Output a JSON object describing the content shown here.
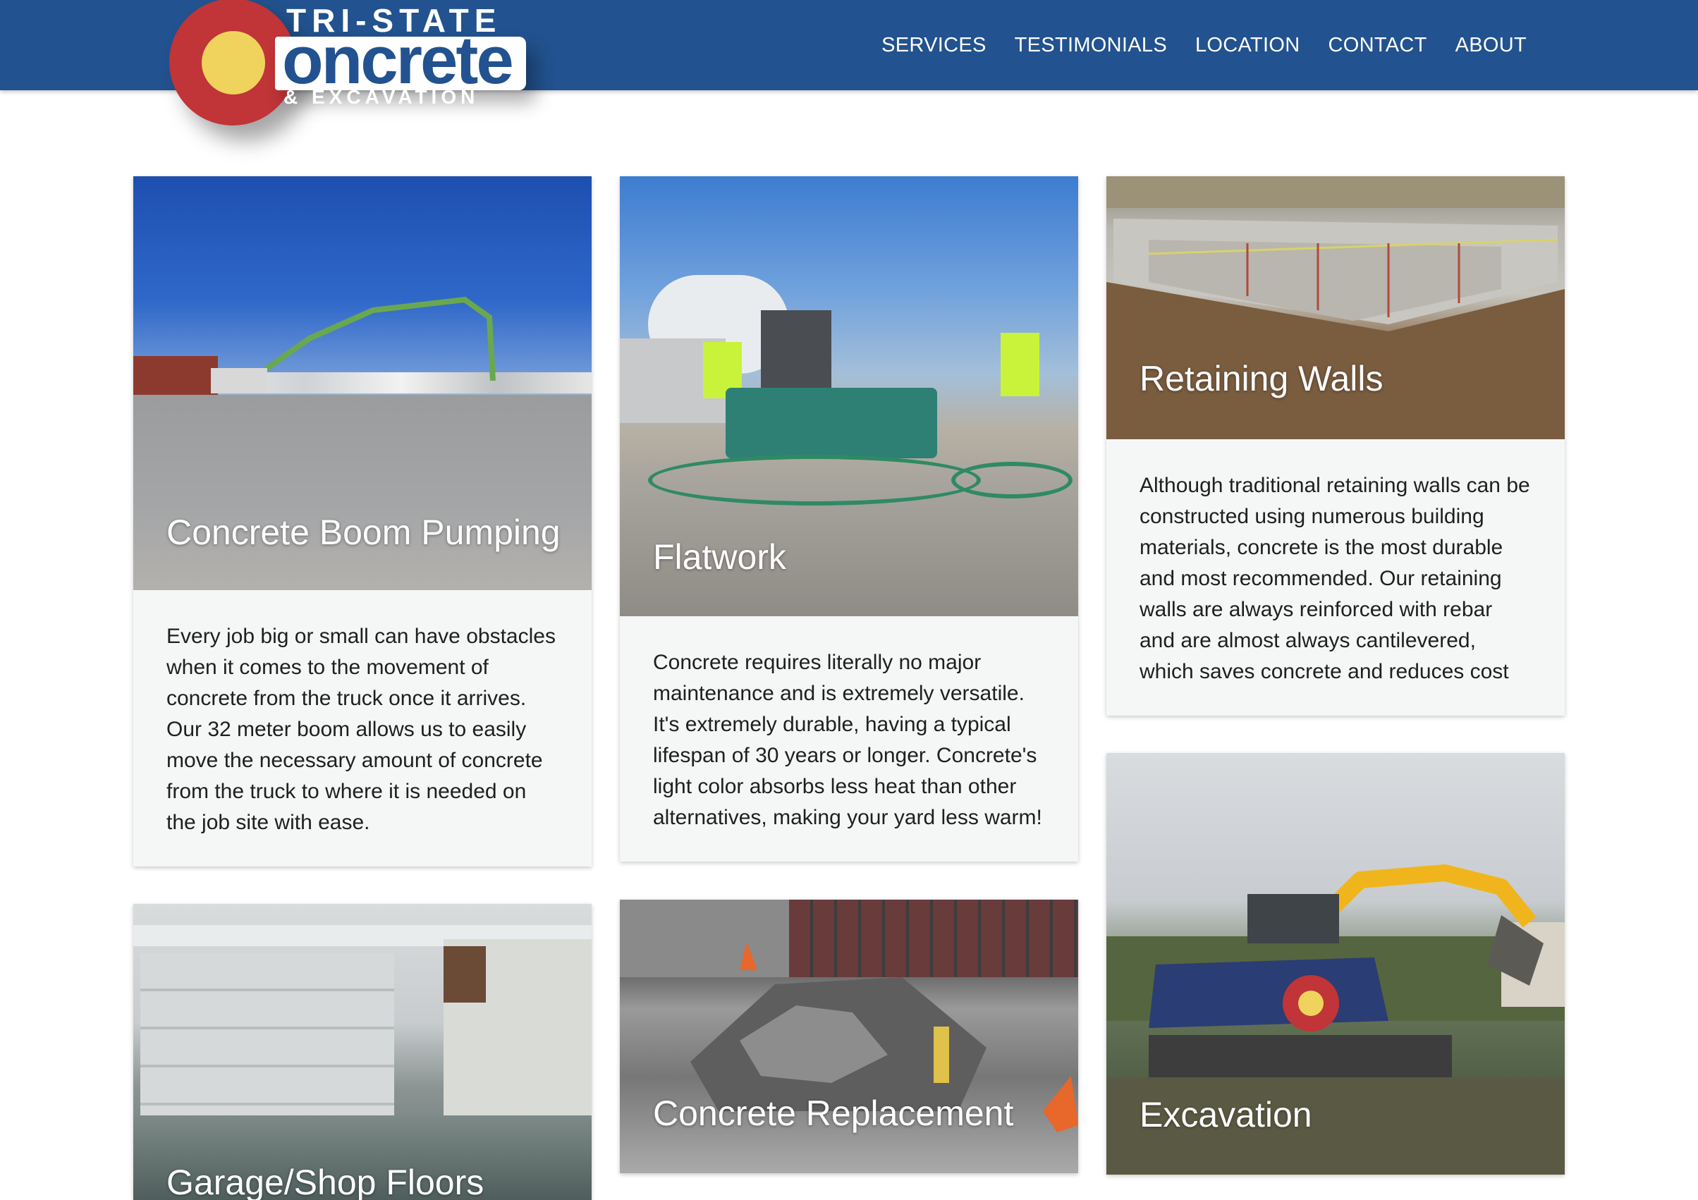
{
  "header": {
    "logo": {
      "line1": "TRI-STATE",
      "line2": "oncrete",
      "line3": "& EXCAVATION"
    },
    "nav": [
      "SERVICES",
      "TESTIMONIALS",
      "LOCATION",
      "CONTACT",
      "ABOUT"
    ],
    "colors": {
      "header_bg": "#22528f",
      "logo_red": "#c13437",
      "logo_yellow": "#f0d35c"
    }
  },
  "services": [
    {
      "title": "Concrete Boom Pumping",
      "text": "Every job big or small can have obstacles when it comes to the movement of concrete from the truck once it arrives. Our 32 meter boom allows us to easily move the necessary amount of concrete from the truck to where it is needed on the job site with ease."
    },
    {
      "title": "Flatwork",
      "text": "Concrete requires literally no major maintenance and is extremely versatile. It's extremely durable, having a typical lifespan of 30 years or longer. Concrete's light color absorbs less heat than other alternatives, making your yard less warm!"
    },
    {
      "title": "Retaining Walls",
      "text": "Although traditional retaining walls can be constructed using numerous building materials, concrete is the most durable and most recommended. Our retaining walls are always reinforced with rebar and are almost always cantilevered, which saves concrete and reduces cost"
    },
    {
      "title": "Garage/Shop Floors"
    },
    {
      "title": "Concrete Replacement"
    },
    {
      "title": "Excavation"
    }
  ]
}
